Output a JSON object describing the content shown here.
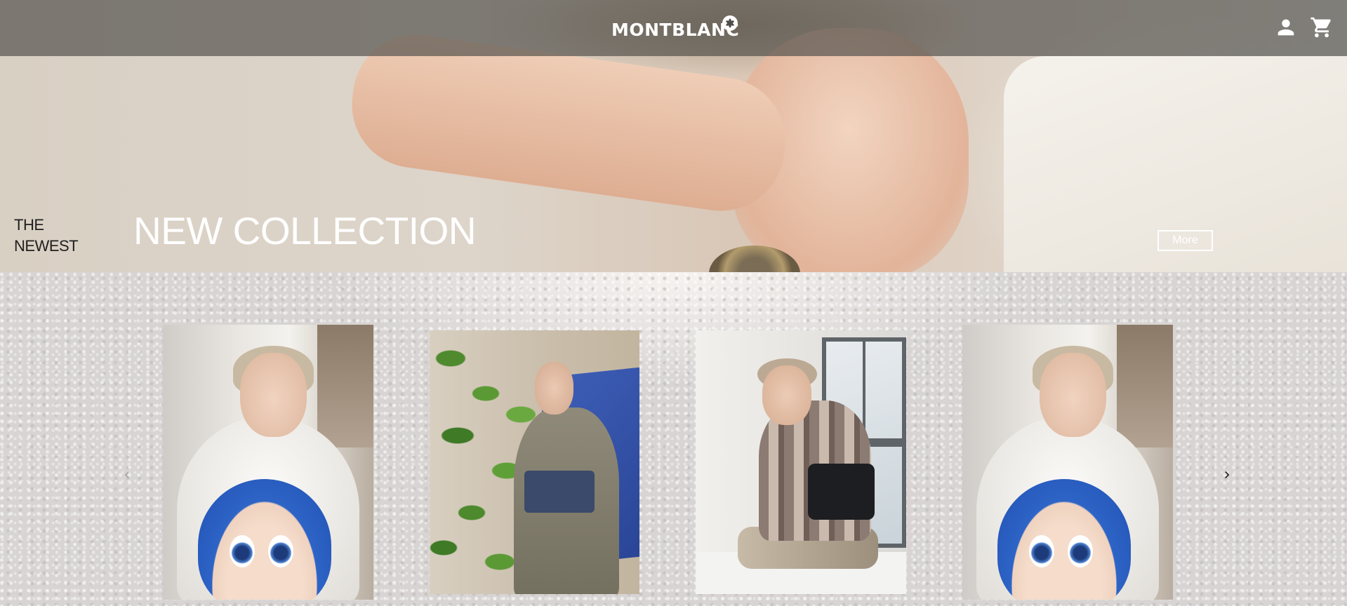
{
  "brand": {
    "name": "MONTBLANC"
  },
  "header": {
    "icons": [
      "account-icon",
      "cart-icon"
    ]
  },
  "hero": {
    "kicker_line1": "THE",
    "kicker_line2": "NEWEST",
    "title": "NEW COLLECTION",
    "more_label": "More"
  },
  "gallery": {
    "prev_icon": "chevron-left-icon",
    "next_icon": "chevron-right-icon",
    "photos": [
      "photo-astro-boy",
      "photo-plant",
      "photo-window",
      "photo-astro-boy"
    ]
  },
  "colors": {
    "header_overlay": "#504e4a",
    "text_light": "#ffffff",
    "text_dark": "#1f1f1f",
    "gallery_bg": "#d7d4d3"
  }
}
